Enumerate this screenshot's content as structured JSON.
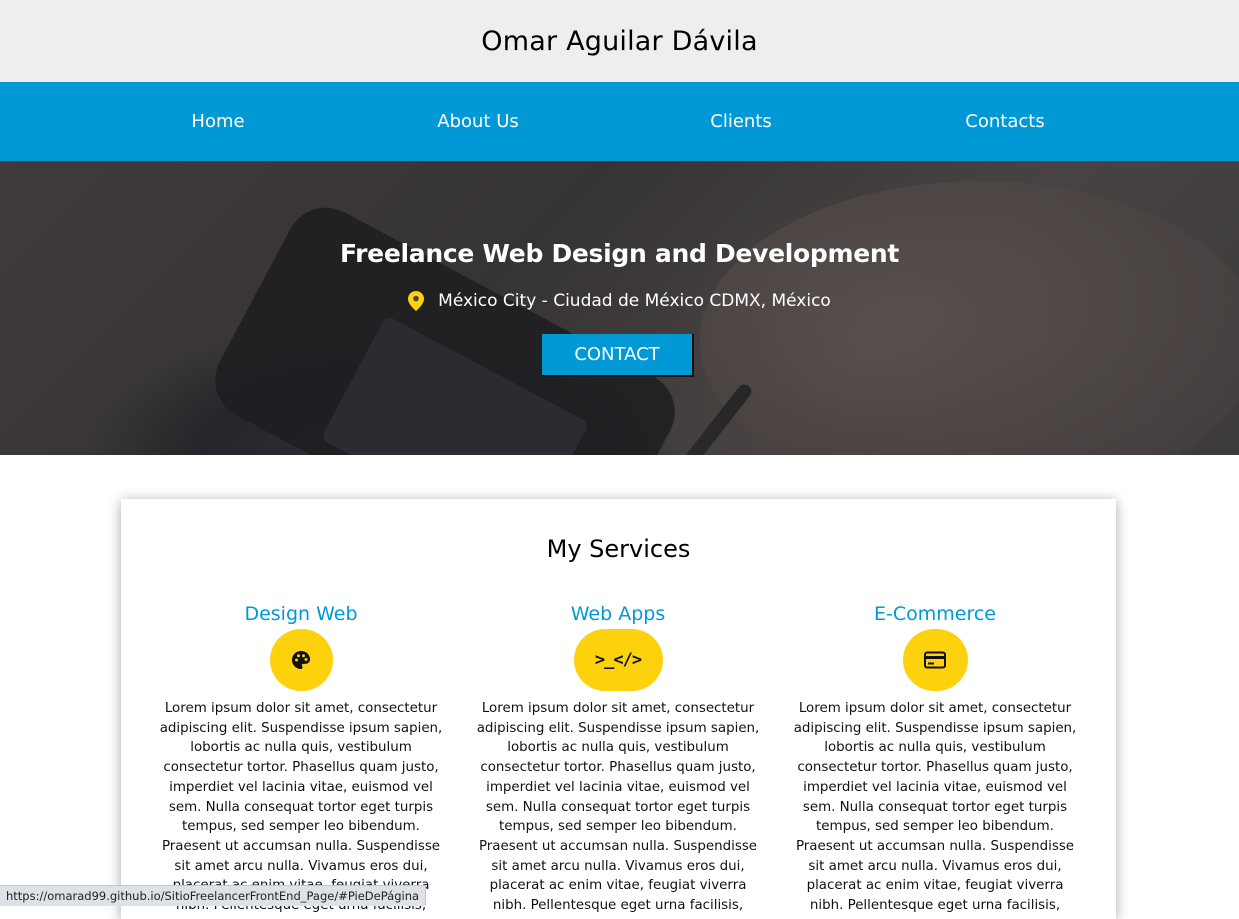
{
  "header": {
    "title": "Omar Aguilar Dávila"
  },
  "nav": {
    "items": [
      {
        "label": "Home"
      },
      {
        "label": "About Us"
      },
      {
        "label": "Clients"
      },
      {
        "label": "Contacts"
      }
    ]
  },
  "hero": {
    "title": "Freelance Web Design and Development",
    "location": "México City - Ciudad de México CDMX, México",
    "location_icon": "map-pin-icon",
    "button_label": "CONTACT"
  },
  "services": {
    "title": "My Services",
    "items": [
      {
        "title": "Design Web",
        "icon": "palette-icon",
        "text": "Lorem ipsum dolor sit amet, consectetur adipiscing elit. Suspendisse ipsum sapien, lobortis ac nulla quis, vestibulum consectetur tortor. Phasellus quam justo, imperdiet vel lacinia vitae, euismod vel sem. Nulla consequat tortor eget turpis tempus, sed semper leo bibendum. Praesent ut accumsan nulla. Suspendisse sit amet arcu nulla. Vivamus eros dui, placerat ac enim vitae, feugiat viverra nibh. Pellentesque eget urna facilisis,"
      },
      {
        "title": "Web Apps",
        "icon": "code-icon",
        "icon_text": ">_</>",
        "text": "Lorem ipsum dolor sit amet, consectetur adipiscing elit. Suspendisse ipsum sapien, lobortis ac nulla quis, vestibulum consectetur tortor. Phasellus quam justo, imperdiet vel lacinia vitae, euismod vel sem. Nulla consequat tortor eget turpis tempus, sed semper leo bibendum. Praesent ut accumsan nulla. Suspendisse sit amet arcu nulla. Vivamus eros dui, placerat ac enim vitae, feugiat viverra nibh. Pellentesque eget urna facilisis,"
      },
      {
        "title": "E-Commerce",
        "icon": "credit-card-icon",
        "text": "Lorem ipsum dolor sit amet, consectetur adipiscing elit. Suspendisse ipsum sapien, lobortis ac nulla quis, vestibulum consectetur tortor. Phasellus quam justo, imperdiet vel lacinia vitae, euismod vel sem. Nulla consequat tortor eget turpis tempus, sed semper leo bibendum. Praesent ut accumsan nulla. Suspendisse sit amet arcu nulla. Vivamus eros dui, placerat ac enim vitae, feugiat viverra nibh. Pellentesque eget urna facilisis,"
      }
    ]
  },
  "status_bar": {
    "url": "https://omarad99.github.io/SitioFreelancerFrontEnd_Page/#PieDePágina"
  },
  "colors": {
    "brand_blue": "#0099d6",
    "accent_yellow": "#fdd20d",
    "header_gray": "#eeeeee"
  }
}
